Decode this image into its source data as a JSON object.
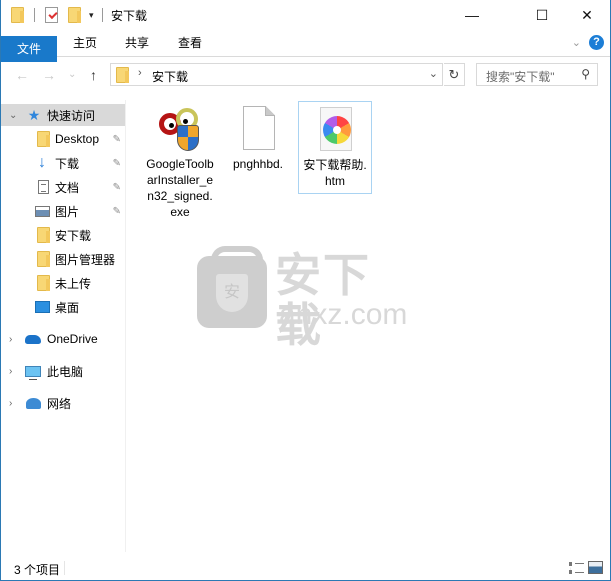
{
  "window": {
    "title": "安下载",
    "controls": {
      "minimize": "—",
      "maximize": "☐",
      "close": "✕"
    }
  },
  "ribbon": {
    "tabs": [
      {
        "label": "文件",
        "active": true
      },
      {
        "label": "主页"
      },
      {
        "label": "共享"
      },
      {
        "label": "查看"
      }
    ],
    "expand_icon": "⌄",
    "help_icon": "?"
  },
  "navigation": {
    "back": "←",
    "forward": "→",
    "recent": "⌄",
    "up": "↑",
    "address": {
      "breadcrumb_sep": "›",
      "crumbs": [
        "安下载"
      ],
      "dropdown": "⌄"
    },
    "refresh": "↻",
    "search": {
      "placeholder": "搜索\"安下载\"",
      "icon": "⚲"
    }
  },
  "sidebar": {
    "quick_access": {
      "label": "快速访问",
      "expand": "⌄",
      "icon": "star-icon"
    },
    "items": [
      {
        "label": "Desktop",
        "icon": "folder-icon",
        "pinned": true
      },
      {
        "label": "下载",
        "icon": "download-icon",
        "pinned": true
      },
      {
        "label": "文档",
        "icon": "document-icon",
        "pinned": true
      },
      {
        "label": "图片",
        "icon": "pictures-icon",
        "pinned": true
      },
      {
        "label": "安下载",
        "icon": "folder-icon",
        "pinned": false
      },
      {
        "label": "图片管理器",
        "icon": "folder-icon",
        "pinned": false
      },
      {
        "label": "未上传",
        "icon": "folder-icon",
        "pinned": false
      },
      {
        "label": "桌面",
        "icon": "desktop-icon",
        "pinned": false
      }
    ],
    "roots": [
      {
        "label": "OneDrive",
        "icon": "onedrive-icon",
        "expand": "›"
      },
      {
        "label": "此电脑",
        "icon": "this-pc-icon",
        "expand": "›"
      },
      {
        "label": "网络",
        "icon": "network-icon",
        "expand": "›"
      }
    ],
    "pin_glyph": "📌"
  },
  "files": [
    {
      "name": "GoogleToolbarInstaller_en32_signed.exe",
      "icon": "installer-icon",
      "selected": false
    },
    {
      "name": "pnghhbd.",
      "icon": "blank-file-icon",
      "selected": false
    },
    {
      "name": "安下载帮助.htm",
      "icon": "htm-file-icon",
      "selected": true
    }
  ],
  "watermark": {
    "cn": "安下载",
    "en": "anxz.com",
    "badge": "安"
  },
  "status": {
    "item_count": "3 个项目"
  }
}
